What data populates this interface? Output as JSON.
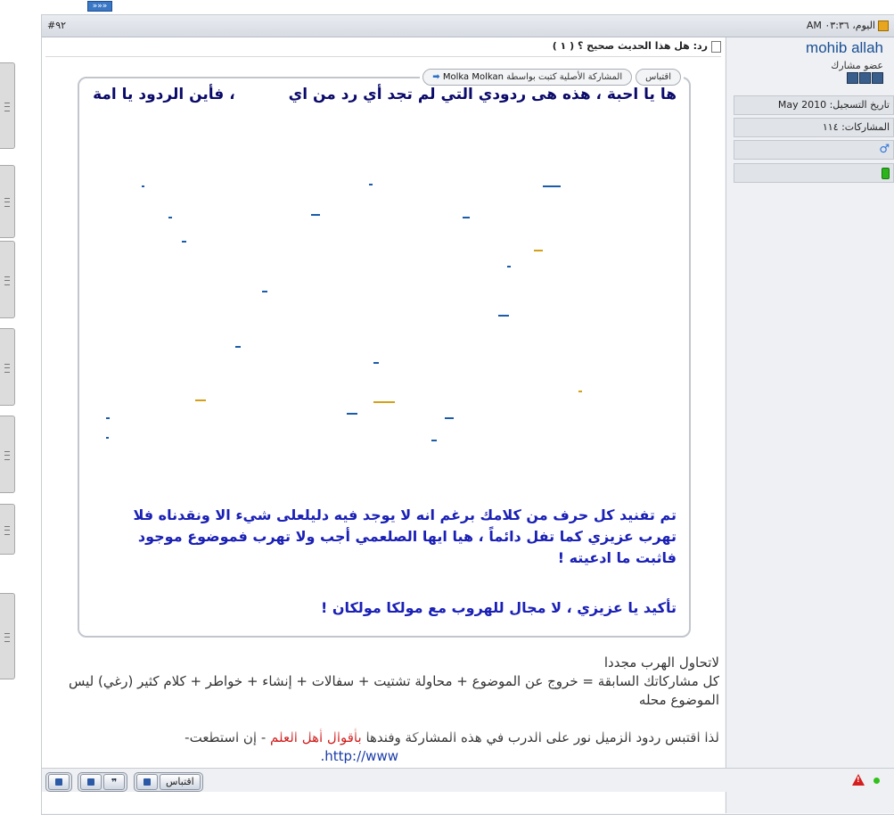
{
  "top_button_label": "»»»",
  "post": {
    "date": "اليوم، ٠٣:٣٦ AM",
    "number": "#٩٢",
    "title": "رد: هل هذا الحديث صحيح ؟ ( ١ )"
  },
  "user": {
    "name": "mohib allah",
    "title": "عضو مشارك",
    "join_date": "تاريخ التسجيل: May 2010",
    "posts": "المشاركات: ١١٤",
    "gender_icon": "male-icon",
    "online_icon": "online-icon"
  },
  "quote": {
    "source_label": "المشاركة الأصلية كتبت بواسطة",
    "author": "Molka Molkan",
    "quote_button": "اقتباس",
    "line1_a": "ها يا احبة ، هذه هى ردودي التي لم تجد أي رد من اي",
    "line1_b": "، فأين الردود يا امة",
    "paragraph1": "تم تفنيد كل حرف من كلامك برغم انه لا يوجد فيه دليلعلى شيء الا ونقدناه فلا تهرب عزيزي كما تفل دائماً ، هيا ايها الصلعمي أجب ولا تهرب فموضوع موجود فاثبت ما ادعيته !",
    "paragraph2": "تأكيد يا عزيزي ، لا مجال للهروب مع مولكا مولكان !"
  },
  "body": {
    "line1": "لاتحاول الهرب مجددا",
    "line2": "كل مشاركاتك السابقة = خروج عن الموضوع + محاولة تشتيت + سفالات + إنشاء + خواطر + كلام كثير (رغي) ليس الموضوع محله",
    "line3_a": "لذا اقتبس ردود الزميل نور على الدرب في هذه المشاركة وفندها ",
    "line3_red": "بأقوال أهل العلم",
    "line3_b": " - إن استطعت-",
    "link": "http://www."
  },
  "footer": {
    "quote_button": "اقتباس",
    "warn_icon": "report-icon",
    "status_icon": "online-status-icon"
  }
}
